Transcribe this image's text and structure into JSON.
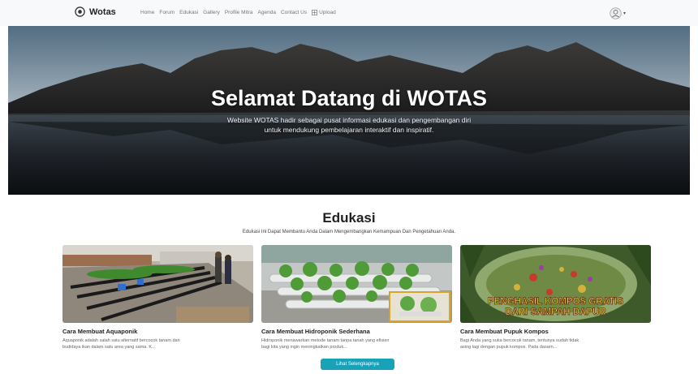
{
  "nav": {
    "brand": "Wotas",
    "links": [
      "Home",
      "Forum",
      "Edukasi",
      "Gallery",
      "Profile Mitra",
      "Agenda",
      "Contact Us"
    ],
    "upload": "Upload",
    "upload_icon": "upload-icon",
    "user_icon": "avatar-icon"
  },
  "hero": {
    "title": "Selamat Datang di WOTAS",
    "subtitle_line1": "Website WOTAS hadir sebagai pusat informasi edukasi dan pengembangan diri",
    "subtitle_line2": "untuk mendukung pembelajaran interaktif dan inspiratif."
  },
  "edukasi": {
    "title": "Edukasi",
    "subtitle": "Edukasi Ini Dapat Membantu Anda Dalam Mengembangkan Kemampuan Dan Pengetahuan Anda.",
    "cards": [
      {
        "title": "Cara Membuat Aquaponik",
        "line1": "Aquaponik adalah salah satu alternatif bercocok tanam dan",
        "line2": "budidaya ikan dalam satu area yang sama. K..."
      },
      {
        "title": "Cara Membuat Hidroponik Sederhana",
        "line1": "Hidroponik menawarkan metode tanam tanpa tanah yang efisien",
        "line2": "bagi kita yang ingin meningkatkan produk..."
      },
      {
        "title": "Cara Membuat Pupuk Kompos",
        "line1": "Bagi Anda yang suka bercocok tanam, tentunya sudah tidak",
        "line2": "asing lagi dengan pupuk kompos. Pada dasarn...",
        "image_caption_line1": "PENGHASIL KOMPOS GRATIS",
        "image_caption_line2": "DARI SAMPAH DAPUR"
      }
    ],
    "button": "Lihat Selengkapnya"
  },
  "colors": {
    "accent": "#17a2b8",
    "navbar_bg": "#f8f9fa",
    "compost_caption": "#f2e64d"
  }
}
